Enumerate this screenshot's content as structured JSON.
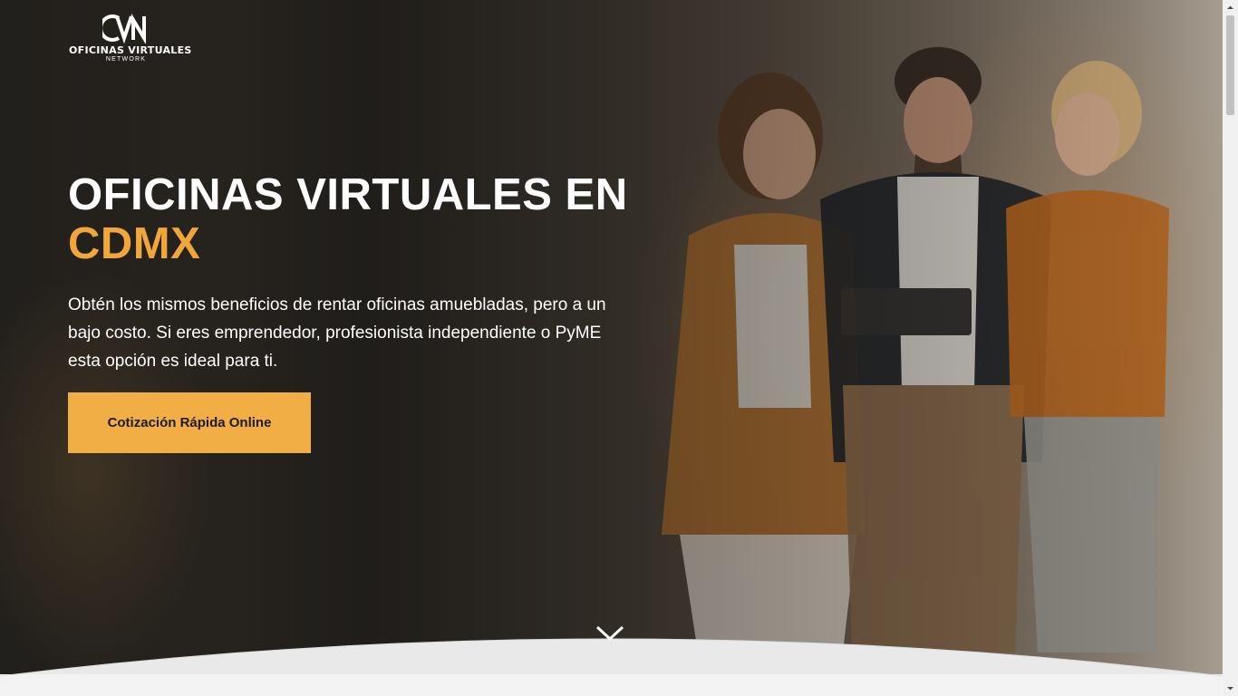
{
  "header": {
    "logo": {
      "monogram": "OVN",
      "name": "OFICINAS VIRTUALES",
      "tagline": "NETWORK"
    }
  },
  "hero": {
    "title_line1": "OFICINAS VIRTUALES EN",
    "title_line2": "CDMX",
    "description": "Obtén los mismos beneficios de rentar oficinas amuebladas, pero a un bajo costo. Si eres emprendedor, profesionista independiente o PyME esta opción es ideal para ti.",
    "cta_label": "Cotización Rápida Online",
    "scroll_icon": "chevron-down-icon"
  },
  "colors": {
    "accent": "#f0a63a",
    "button": "#f0ae45",
    "text": "#ffffff",
    "wave": "#e9e9ea"
  }
}
